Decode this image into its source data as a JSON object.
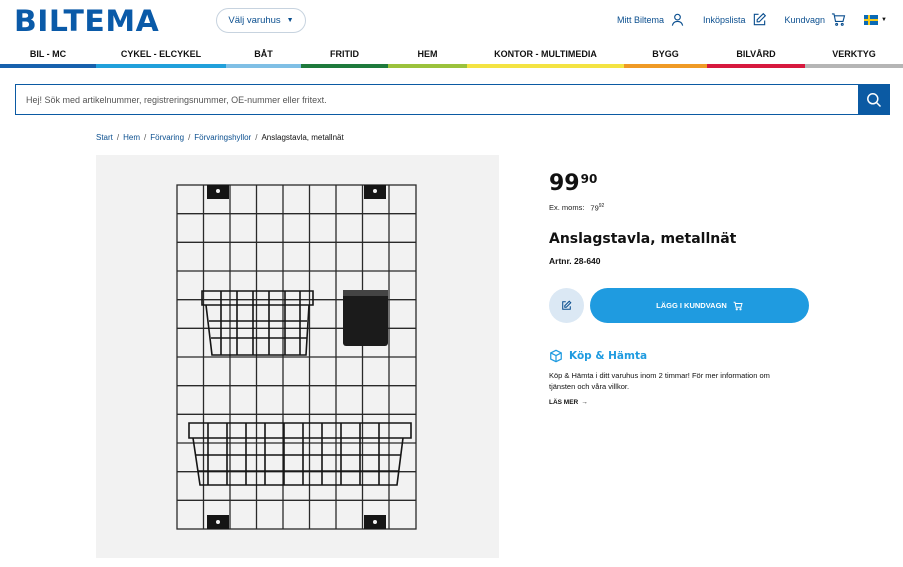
{
  "brand": {
    "logo_text": "BILTEMA",
    "color": "#0a5aa8"
  },
  "header": {
    "store_selector": "Välj varuhus",
    "links": [
      {
        "label": "Mitt Biltema",
        "icon": "user-icon"
      },
      {
        "label": "Inköpslista",
        "icon": "edit-icon"
      },
      {
        "label": "Kundvagn",
        "icon": "cart-icon"
      }
    ],
    "language_flag": "swedish-flag-icon"
  },
  "nav": {
    "items": [
      {
        "label": "BIL - MC",
        "color": "#1761ad"
      },
      {
        "label": "CYKEL - ELCYKEL",
        "color": "#21a0db"
      },
      {
        "label": "BÅT",
        "color": "#7fbfe5"
      },
      {
        "label": "FRITID",
        "color": "#1e7a3c"
      },
      {
        "label": "HEM",
        "color": "#9bc23c"
      },
      {
        "label": "KONTOR - MULTIMEDIA",
        "color": "#f3e342"
      },
      {
        "label": "BYGG",
        "color": "#ef9a25"
      },
      {
        "label": "BILVÅRD",
        "color": "#d7193e"
      },
      {
        "label": "VERKTYG",
        "color": "#b5b5b5"
      }
    ]
  },
  "search": {
    "placeholder": "Hej! Sök med artikelnummer, registreringsnummer, OE-nummer eller fritext."
  },
  "breadcrumb": {
    "links": [
      "Start",
      "Hem",
      "Förvaring",
      "Förvaringshyllor"
    ],
    "separator": "/",
    "current": "Anslagstavla, metallnät"
  },
  "product": {
    "price_main": "99",
    "price_decimals": "90",
    "ex_moms_label": "Ex. moms:",
    "ex_moms_main": "79",
    "ex_moms_decimals": "92",
    "title": "Anslagstavla, metallnät",
    "artnr": "Artnr. 28-640",
    "add_to_cart": "LÄGG I KUNDVAGN",
    "kop_hamta_title": "Köp & Hämta",
    "kop_hamta_text": "Köp & Hämta i ditt varuhus inom 2 timmar! För mer information om tjänsten och våra villkor.",
    "read_more": "LÄS MER",
    "accent_color": "#1f9be0"
  }
}
